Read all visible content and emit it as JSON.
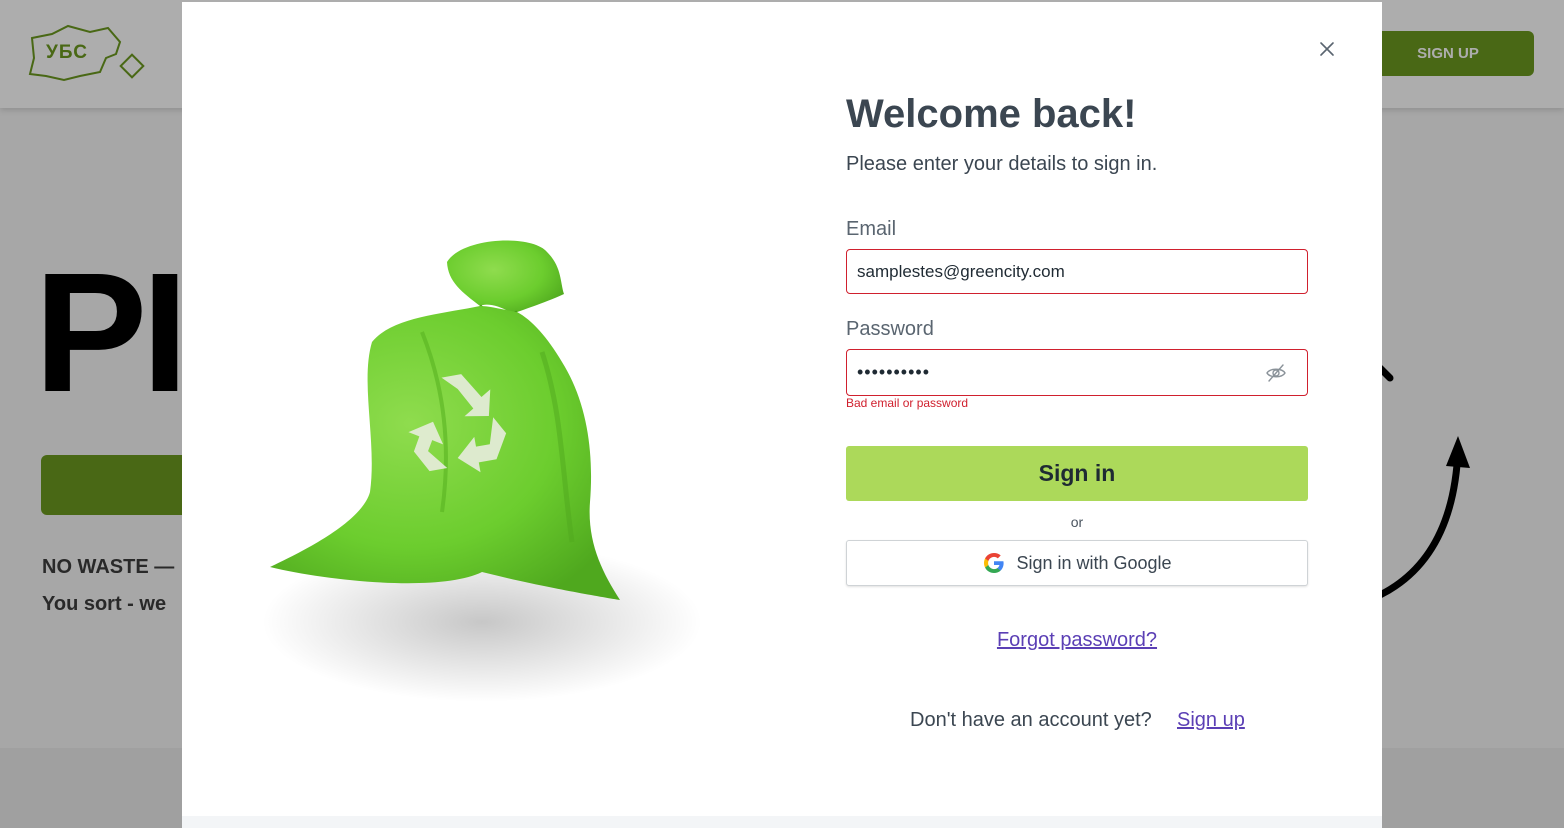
{
  "background": {
    "logo_text": "УБС",
    "signup_button_label": "SIGN UP",
    "hero_title": "PI",
    "tagline_1": "NO WASTE —",
    "tagline_2": "You sort - we"
  },
  "modal": {
    "title": "Welcome back!",
    "subtitle": "Please enter your details to sign in.",
    "email": {
      "label": "Email",
      "value": "samplestes@greencity.com"
    },
    "password": {
      "label": "Password",
      "value": "••••••••••",
      "error": "Bad email or password"
    },
    "signin_button_label": "Sign in",
    "or_text": "or",
    "google_button_label": "Sign in with Google",
    "forgot_password_link": "Forgot password?",
    "no_account_text": "Don't have an account yet?",
    "signup_link": "Sign up",
    "icons": {
      "close": "close-icon",
      "eye": "eye-off-icon",
      "google": "google-icon",
      "illustration": "recycle-bag-illustration"
    }
  },
  "colors": {
    "accent_green": "#acd95a",
    "brand_green": "#6c9a1f",
    "error_red": "#d0202e",
    "link_purple": "#5b3fb5",
    "title_text": "#3b4651"
  }
}
